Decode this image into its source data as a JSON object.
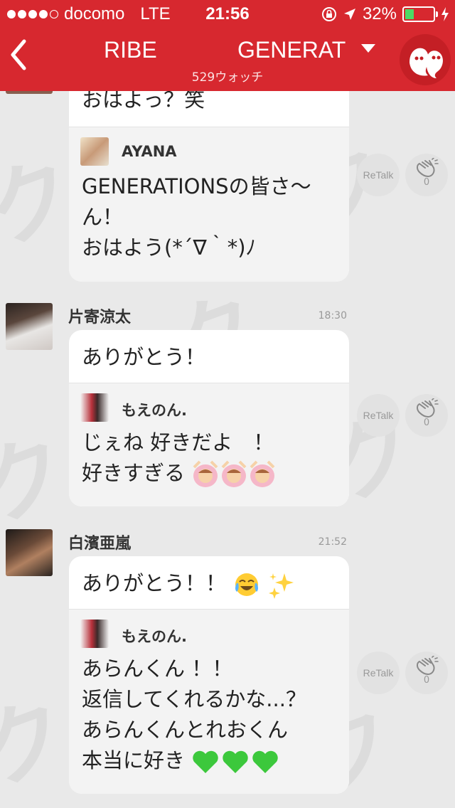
{
  "status_bar": {
    "carrier": "docomo",
    "network": "LTE",
    "time": "21:56",
    "battery_percent": "32%",
    "battery_level": 0.32
  },
  "header": {
    "title_left": "RIBE",
    "title_right": "GENERAT",
    "watch_count": "529ウォッチ",
    "background_color": "#d7282f"
  },
  "messages": [
    {
      "sender": "",
      "time": "",
      "main_text": "おはよっ？笑",
      "reply": {
        "name": "AYANA",
        "lines": [
          "GENERATIONSの皆さ〜",
          "ん！",
          "おはよう(*´∇｀*)ﾉ"
        ]
      },
      "retalk_label": "ReTalk",
      "clap_count": "0"
    },
    {
      "sender": "片寄涼太",
      "time": "18:30",
      "main_text": "ありがとう！",
      "reply": {
        "name": "もえのん.",
        "lines": [
          "じぇね 好きだよ　！",
          "好きすぎる"
        ]
      },
      "retalk_label": "ReTalk",
      "clap_count": "0"
    },
    {
      "sender": "白濱亜嵐",
      "time": "21:52",
      "main_text": "ありがとう！！",
      "reply": {
        "name": "もえのん.",
        "lines": [
          "あらんくん ！！",
          "返信してくれるかな...？",
          "あらんくんとれおくん",
          "本当に好き"
        ]
      },
      "retalk_label": "ReTalk",
      "clap_count": "0"
    }
  ],
  "icons": {
    "back": "chevron-left-icon",
    "dropdown": "caret-down-icon",
    "ghost": "ghost-icon",
    "clap": "clap-icon"
  }
}
